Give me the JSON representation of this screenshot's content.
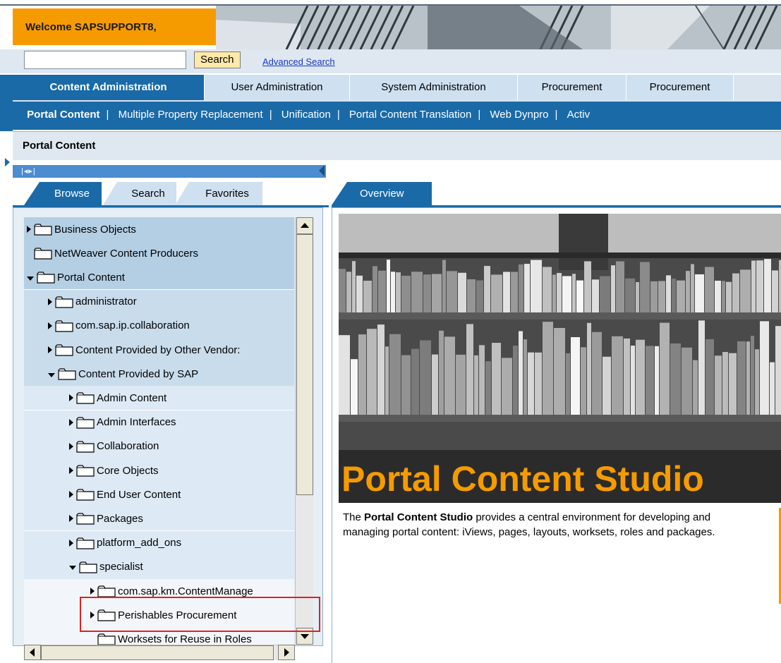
{
  "header": {
    "welcome_text": "Welcome SAPSUPPORT8,"
  },
  "search": {
    "input_value": "",
    "button_label": "Search",
    "advanced_link": "Advanced Search"
  },
  "top_nav": [
    {
      "label": "Content Administration",
      "active": true
    },
    {
      "label": "User Administration",
      "active": false
    },
    {
      "label": "System Administration",
      "active": false
    },
    {
      "label": "Procurement",
      "active": false
    },
    {
      "label": "Procurement",
      "active": false
    }
  ],
  "sub_nav": [
    {
      "label": "Portal Content",
      "active": true
    },
    {
      "label": "Multiple Property Replacement",
      "active": false
    },
    {
      "label": "Unification",
      "active": false
    },
    {
      "label": "Portal Content Translation",
      "active": false
    },
    {
      "label": "Web Dynpro",
      "active": false
    },
    {
      "label": "Activ",
      "active": false
    }
  ],
  "page_title": "Portal Content",
  "left_tabs": [
    {
      "label": "Browse",
      "active": true
    },
    {
      "label": "Search",
      "active": false
    },
    {
      "label": "Favorites",
      "active": false
    }
  ],
  "tree": [
    {
      "label": "Business Objects",
      "level": 0,
      "state": "collapsed"
    },
    {
      "label": "NetWeaver Content Producers",
      "level": 0,
      "state": "leaf"
    },
    {
      "label": "Portal Content",
      "level": 0,
      "state": "expanded"
    },
    {
      "label": "administrator",
      "level": 1,
      "state": "collapsed"
    },
    {
      "label": "com.sap.ip.collaboration",
      "level": 1,
      "state": "collapsed"
    },
    {
      "label": "Content Provided by Other Vendor:",
      "level": 1,
      "state": "collapsed"
    },
    {
      "label": "Content Provided by SAP",
      "level": 1,
      "state": "expanded"
    },
    {
      "label": "Admin Content",
      "level": 2,
      "state": "collapsed"
    },
    {
      "label": "Admin Interfaces",
      "level": 2,
      "state": "collapsed"
    },
    {
      "label": "Collaboration",
      "level": 2,
      "state": "collapsed"
    },
    {
      "label": "Core Objects",
      "level": 2,
      "state": "collapsed"
    },
    {
      "label": "End User Content",
      "level": 2,
      "state": "collapsed"
    },
    {
      "label": "Packages",
      "level": 2,
      "state": "collapsed"
    },
    {
      "label": "platform_add_ons",
      "level": 2,
      "state": "collapsed"
    },
    {
      "label": "specialist",
      "level": 2,
      "state": "expanded"
    },
    {
      "label": "com.sap.km.ContentManage",
      "level": 3,
      "state": "collapsed"
    },
    {
      "label": "Perishables Procurement",
      "level": 3,
      "state": "collapsed"
    },
    {
      "label": "Worksets for Reuse in Roles",
      "level": 3,
      "state": "leaf"
    }
  ],
  "right": {
    "tab_label": "Overview",
    "hero_title": "Portal Content Studio",
    "desc_prefix": "The ",
    "desc_bold": "Portal Content Studio",
    "desc_rest": " provides a central environment for developing and managing portal content: iViews, pages, layouts, worksets, roles and packages."
  },
  "colors": {
    "accent_orange": "#f59b00",
    "nav_blue": "#1a6aa8",
    "highlight_red": "#e02020"
  }
}
